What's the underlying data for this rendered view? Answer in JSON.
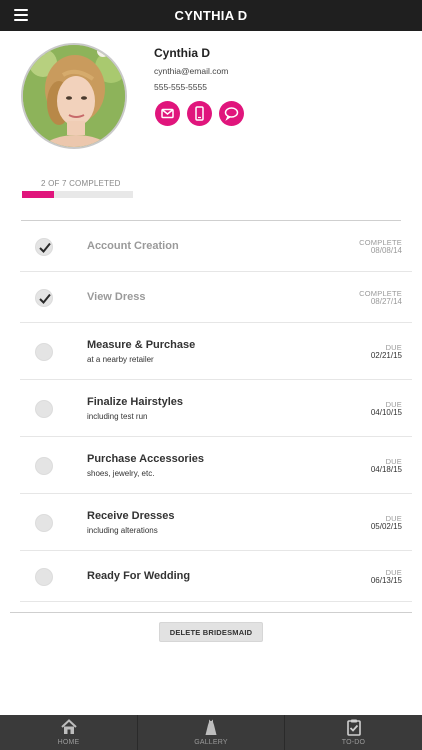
{
  "header": {
    "title": "CYNTHIA D"
  },
  "profile": {
    "name": "Cynthia D",
    "email": "cynthia@email.com",
    "phone": "555-555-5555",
    "actions": [
      "email-icon",
      "phone-icon",
      "chat-icon"
    ]
  },
  "progress": {
    "label": "2 OF 7 COMPLETED",
    "completed": 2,
    "total": 7
  },
  "colors": {
    "accent": "#e0157c",
    "topbar": "#1f1f1f",
    "bottomnav": "#3a3a3a"
  },
  "tasks": [
    {
      "title": "Account Creation",
      "subtitle": "",
      "status": "COMPLETE",
      "date": "08/08/14",
      "done": true
    },
    {
      "title": "View Dress",
      "subtitle": "",
      "status": "COMPLETE",
      "date": "08/27/14",
      "done": true
    },
    {
      "title": "Measure & Purchase",
      "subtitle": "at a nearby retailer",
      "status": "DUE",
      "date": "02/21/15",
      "done": false
    },
    {
      "title": "Finalize Hairstyles",
      "subtitle": "including test run",
      "status": "DUE",
      "date": "04/10/15",
      "done": false
    },
    {
      "title": "Purchase Accessories",
      "subtitle": "shoes, jewelry, etc.",
      "status": "DUE",
      "date": "04/18/15",
      "done": false
    },
    {
      "title": "Receive Dresses",
      "subtitle": "including alterations",
      "status": "DUE",
      "date": "05/02/15",
      "done": false
    },
    {
      "title": "Ready For Wedding",
      "subtitle": "",
      "status": "DUE",
      "date": "06/13/15",
      "done": false
    }
  ],
  "delete_button": {
    "label": "DELETE BRIDESMAID"
  },
  "nav": [
    {
      "label": "HOME",
      "icon": "home-icon"
    },
    {
      "label": "GALLERY",
      "icon": "dress-icon"
    },
    {
      "label": "TO-DO",
      "icon": "clipboard-check-icon"
    }
  ]
}
